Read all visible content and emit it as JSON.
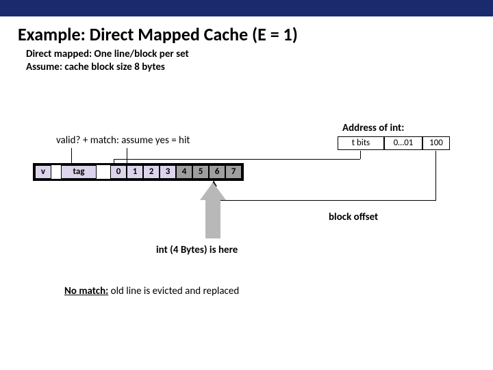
{
  "header": {
    "title": "Example: Direct Mapped Cache (E = 1)",
    "sub1": "Direct mapped: One line/block per set",
    "sub2": "Assume: cache block size 8 bytes"
  },
  "hit": {
    "valid": "valid?",
    "plus": "  +  ",
    "match": "match: assume yes = hit"
  },
  "cache": {
    "v": "v",
    "tag": "tag",
    "bytes": [
      "0",
      "1",
      "2",
      "3",
      "4",
      "5",
      "6",
      "7"
    ],
    "highlight_start": 4,
    "highlight_end": 7
  },
  "address": {
    "title": "Address of int:",
    "t": "t bits",
    "s": "0…01",
    "b": "100"
  },
  "labels": {
    "block_offset": "block offset",
    "int_here": "int (4 Bytes) is here",
    "no_match_label": "No match:",
    "no_match_rest": " old line is evicted and replaced"
  }
}
